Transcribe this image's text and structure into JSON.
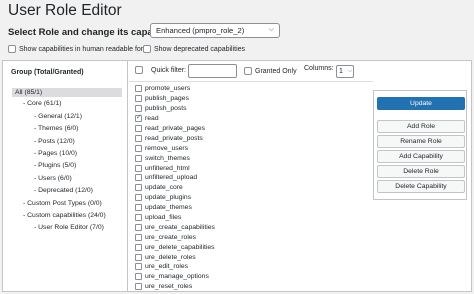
{
  "title": "User Role Editor",
  "role_selector": {
    "label": "Select Role and change its capabilities:",
    "selected": "Enhanced (pmpro_role_2)"
  },
  "options": {
    "human_readable": "Show capabilities in human readable form",
    "deprecated": "Show deprecated capabilities"
  },
  "groups": {
    "header": "Group (Total/Granted)",
    "items": [
      "All (85/1)",
      "- Core (61/1)",
      "- General (12/1)",
      "- Themes (6/0)",
      "- Posts (12/0)",
      "- Pages (10/0)",
      "- Plugins (5/0)",
      "- Users (6/0)",
      "- Deprecated (12/0)",
      "- Custom Post Types (0/0)",
      "- Custom capabilities (24/0)",
      "- User Role Editor (7/0)"
    ]
  },
  "filter": {
    "quick_filter_label": "Quick filter:",
    "granted_only_label": "Granted Only",
    "columns_label": "Columns:",
    "columns_value": "1"
  },
  "capabilities": [
    {
      "name": "promote_users",
      "checked": false
    },
    {
      "name": "publish_pages",
      "checked": false
    },
    {
      "name": "publish_posts",
      "checked": false
    },
    {
      "name": "read",
      "checked": true
    },
    {
      "name": "read_private_pages",
      "checked": false
    },
    {
      "name": "read_private_posts",
      "checked": false
    },
    {
      "name": "remove_users",
      "checked": false
    },
    {
      "name": "switch_themes",
      "checked": false
    },
    {
      "name": "unfiltered_html",
      "checked": false
    },
    {
      "name": "unfiltered_upload",
      "checked": false
    },
    {
      "name": "update_core",
      "checked": false
    },
    {
      "name": "update_plugins",
      "checked": false
    },
    {
      "name": "update_themes",
      "checked": false
    },
    {
      "name": "upload_files",
      "checked": false
    },
    {
      "name": "ure_create_capabilities",
      "checked": false
    },
    {
      "name": "ure_create_roles",
      "checked": false
    },
    {
      "name": "ure_delete_capabilities",
      "checked": false
    },
    {
      "name": "ure_delete_roles",
      "checked": false
    },
    {
      "name": "ure_edit_roles",
      "checked": false
    },
    {
      "name": "ure_manage_options",
      "checked": false
    },
    {
      "name": "ure_reset_roles",
      "checked": false
    }
  ],
  "actions": {
    "update": "Update",
    "add_role": "Add Role",
    "rename_role": "Rename Role",
    "add_capability": "Add Capability",
    "delete_role": "Delete Role",
    "delete_capability": "Delete Capability"
  },
  "colors": {
    "accent": "#2271b1",
    "selected_group_bg": "#dcdcde"
  },
  "icons": {
    "select_arrow": "chevron-down-icon",
    "checkbox_checked": "checkmark-icon"
  }
}
